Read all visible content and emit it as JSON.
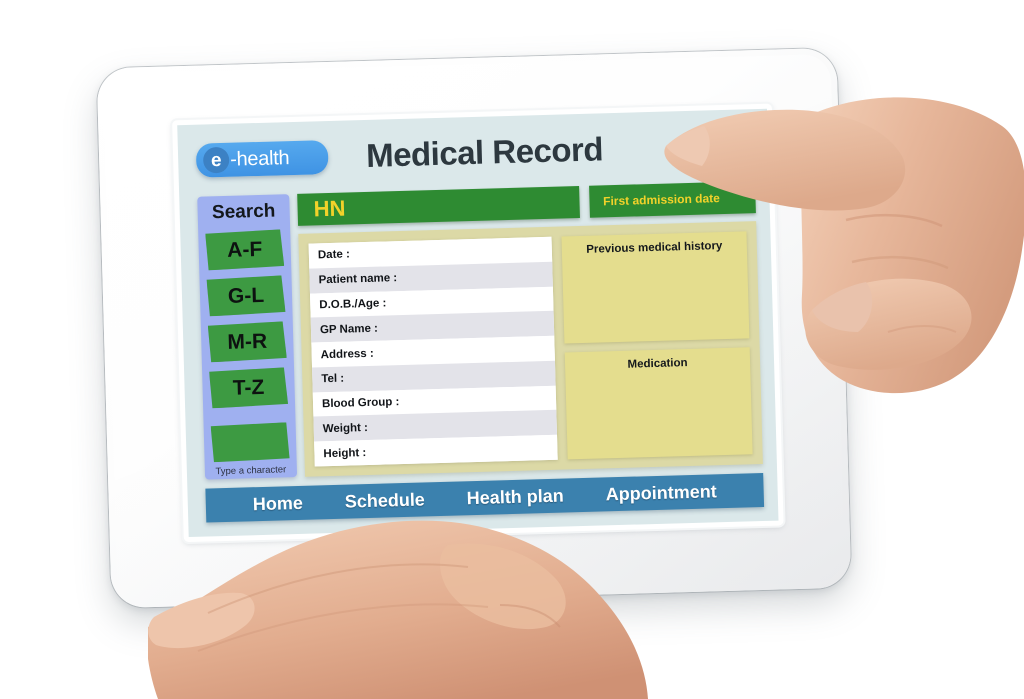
{
  "app": {
    "logo_initial": "e",
    "logo_text": "-health",
    "title": "Medical Record"
  },
  "sidebar": {
    "label": "Search",
    "buttons": [
      {
        "label": "A-F"
      },
      {
        "label": "G-L"
      },
      {
        "label": "M-R"
      },
      {
        "label": "T-Z"
      }
    ],
    "type_hint": "Type a character"
  },
  "bars": {
    "hn": "HN",
    "first_admission": "First admission date"
  },
  "fields": [
    {
      "label": "Date :",
      "value": ""
    },
    {
      "label": "Patient name :",
      "value": ""
    },
    {
      "label": "D.O.B./Age :",
      "value": ""
    },
    {
      "label": "GP Name :",
      "value": ""
    },
    {
      "label": "Address :",
      "value": ""
    },
    {
      "label": "Tel :",
      "value": ""
    },
    {
      "label": "Blood Group :",
      "value": ""
    },
    {
      "label": "Weight :",
      "value": ""
    },
    {
      "label": "Height :",
      "value": ""
    }
  ],
  "notes": [
    {
      "title": "Previous medical history",
      "value": ""
    },
    {
      "title": "Medication",
      "value": ""
    }
  ],
  "nav": [
    {
      "label": "Home"
    },
    {
      "label": "Schedule"
    },
    {
      "label": "Health plan"
    },
    {
      "label": "Appointment"
    }
  ],
  "colors": {
    "screen_bg": "#dbe8ea",
    "sidebar": "#9fb0f0",
    "green_button": "#3d9a42",
    "green_bar": "#2e8b32",
    "green_bar_text": "#f2d22a",
    "panel_bg": "#dcd9a6",
    "note_bg": "#e4dd8e",
    "nav_bg": "#3b81ae",
    "logo_blue": "#3f93e4",
    "title_text": "#2d383f",
    "field_alt": "#e3e3e9"
  }
}
